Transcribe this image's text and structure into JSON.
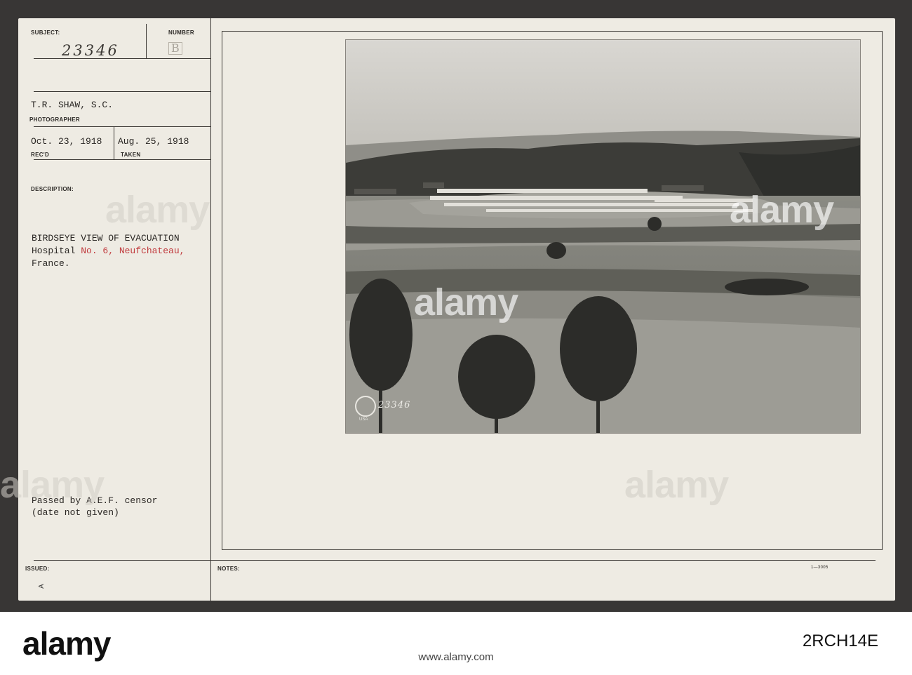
{
  "card": {
    "subject_label": "SUBJECT:",
    "subject_number": "23346",
    "number_label": "NUMBER",
    "number_value": "B",
    "photographer": "T.R. SHAW, S.C.",
    "photographer_label": "PHOTOGRAPHER",
    "recd_date": "Oct. 23, 1918",
    "recd_label": "REC'D",
    "taken_date": "Aug. 25, 1918",
    "taken_label": "TAKEN",
    "description_label": "DESCRIPTION:",
    "description_line1": "BIRDSEYE VIEW OF EVACUATION",
    "description_line2_a": "Hospital ",
    "description_line2_b": "No. 6, Neufchateau,",
    "description_line3": "France.",
    "censor_line1": "Passed by A.E.F. censor",
    "censor_line2": "(date not given)",
    "issued_label": "ISSUED:",
    "issued_mark": "A",
    "notes_label": "NOTES:",
    "form_code": "1—3005"
  },
  "photo": {
    "stamp_number": "23346",
    "stamp_text": "USA"
  },
  "watermark": {
    "text": "alamy"
  },
  "footer": {
    "brand": "alamy",
    "image_id": "2RCH14E",
    "url": "www.alamy.com"
  }
}
